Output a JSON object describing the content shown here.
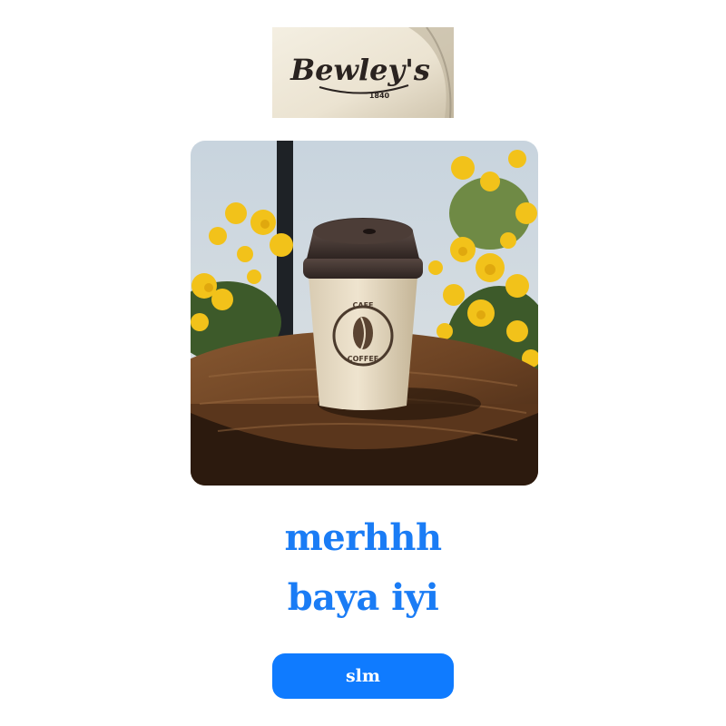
{
  "logo": {
    "brand": "Bewley's",
    "year": "1840"
  },
  "photo": {
    "cup_text_top": "CAFE",
    "cup_text_bottom": "COFFEE"
  },
  "headline": {
    "line1": "merhhh",
    "line2": "baya iyi"
  },
  "button": {
    "label": "slm"
  },
  "colors": {
    "accent_text": "#1a7cf5",
    "button_bg": "#0f7bff",
    "button_text": "#ffffff",
    "background": "#ffffff"
  }
}
